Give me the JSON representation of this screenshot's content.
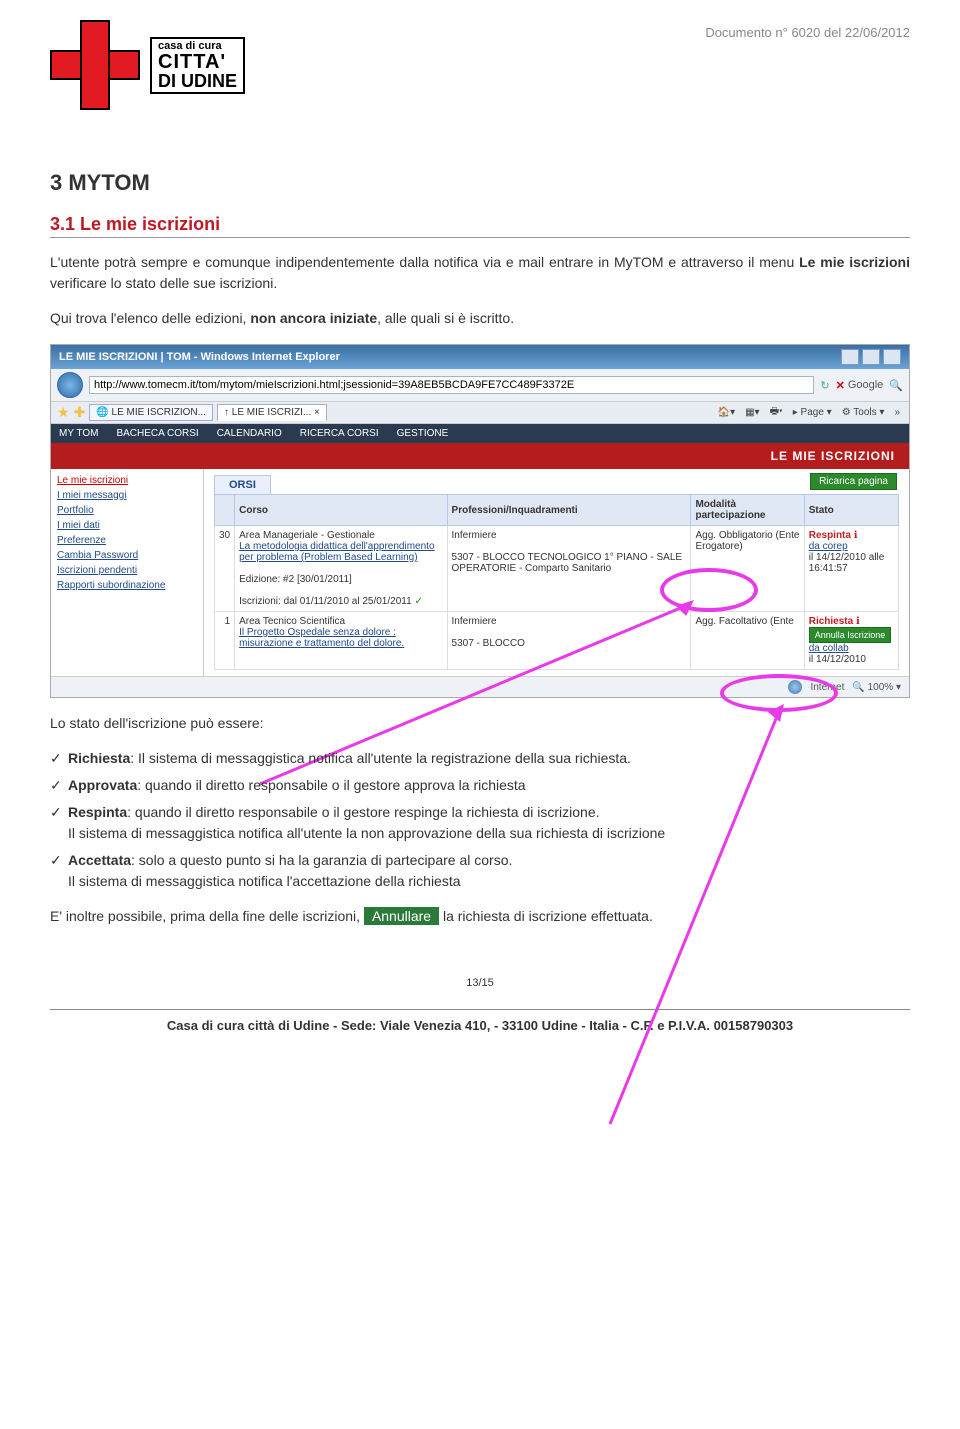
{
  "header": {
    "doc_number": "Documento n° 6020 del 22/06/2012",
    "logo": {
      "line1": "casa di cura",
      "line2": "CITTA'",
      "line3": "DI UDINE"
    }
  },
  "section": {
    "num_title": "3  MYTOM",
    "sub_title": "3.1 Le mie iscrizioni",
    "para1_a": "L'utente potrà sempre e comunque indipendentemente dalla notifica via e mail entrare in MyTOM e attraverso il menu ",
    "para1_bold": "Le mie iscrizioni",
    "para1_b": " verificare lo stato delle sue iscrizioni.",
    "para2_a": "Qui trova l'elenco delle edizioni, ",
    "para2_bold": "non ancora iniziate",
    "para2_b": ", alle quali si è iscritto."
  },
  "ie": {
    "title": "LE MIE ISCRIZIONI | TOM - Windows Internet Explorer",
    "url": "http://www.tomecm.it/tom/mytom/mieIscrizioni.html;jsessionid=39A8EB5BCDA9FE7CC489F3372E",
    "search_hint": "Google",
    "tab1": "LE MIE ISCRIZION...",
    "tab2": "LE MIE ISCRIZI...",
    "page_btn": "Page",
    "tools_btn": "Tools",
    "status_net": "Internet",
    "status_zoom": "100%"
  },
  "tom": {
    "menu": [
      "MY TOM",
      "BACHECA CORSI",
      "CALENDARIO",
      "RICERCA CORSI",
      "GESTIONE"
    ],
    "red_title": "LE MIE ISCRIZIONI",
    "side": [
      "Le mie iscrizioni",
      "I miei messaggi",
      "Portfolio",
      "I miei dati",
      "Preferenze",
      "Cambia Password",
      "Iscrizioni pendenti",
      "Rapporti subordinazione"
    ],
    "orsi": "ORSI",
    "ricarica": "Ricarica pagina",
    "headers": [
      "",
      "Corso",
      "Professioni/Inquadramenti",
      "Modalità partecipazione",
      "Stato"
    ],
    "row1": {
      "n": "30",
      "area": "Area Manageriale - Gestionale",
      "corso": "La metodologia didattica dell'apprendimento per problema (Problem Based Learning)",
      "ediz": "Edizione: #2 [30/01/2011]",
      "iscr": "Iscrizioni: dal 01/11/2010 al 25/01/2011",
      "prof": "Infermiere\n\n5307 - BLOCCO TECNOLOGICO 1° PIANO - SALE OPERATORIE - Comparto Sanitario",
      "mod": "Agg. Obbligatorio (Ente Erogatore)",
      "stato": "Respinta",
      "stato_by": "da corep",
      "stato_date": "il 14/12/2010 alle 16:41:57"
    },
    "row2": {
      "n": "1",
      "area": "Area Tecnico Scientifica",
      "corso": "Il Progetto Ospedale senza dolore : misurazione e trattamento del dolore.",
      "prof": "Infermiere\n\n5307 - BLOCCO",
      "mod": "Agg. Facoltativo (Ente",
      "stato": "Richiesta",
      "stato_by": "da collab",
      "stato_date": "il 14/12/2010",
      "annulla": "Annulla Iscrizione"
    }
  },
  "states": {
    "intro": "Lo stato dell'iscrizione può essere:",
    "items": [
      {
        "bold": "Richiesta",
        "text": ": Il sistema di messaggistica notifica all'utente la registrazione della sua richiesta."
      },
      {
        "bold": "Approvata",
        "text": ": quando il diretto responsabile o il gestore approva la richiesta"
      },
      {
        "bold": "Respinta",
        "text": ": quando il diretto responsabile o il gestore respinge la richiesta di iscrizione.\nIl sistema di messaggistica notifica all'utente la non approvazione della sua richiesta di iscrizione"
      },
      {
        "bold": "Accettata",
        "text": ": solo a questo punto si ha la garanzia di partecipare al corso.\nIl sistema di messaggistica notifica l'accettazione della richiesta"
      }
    ],
    "outro_a": "E' inoltre  possibile, prima della fine delle iscrizioni, ",
    "outro_btn": "Annullare",
    "outro_b": " la richiesta di iscrizione effettuata."
  },
  "page_num": "13/15",
  "footer": "Casa di cura città di Udine - Sede: Viale Venezia 410, - 33100 Udine - Italia - C.F. e P.I.V.A. 00158790303"
}
